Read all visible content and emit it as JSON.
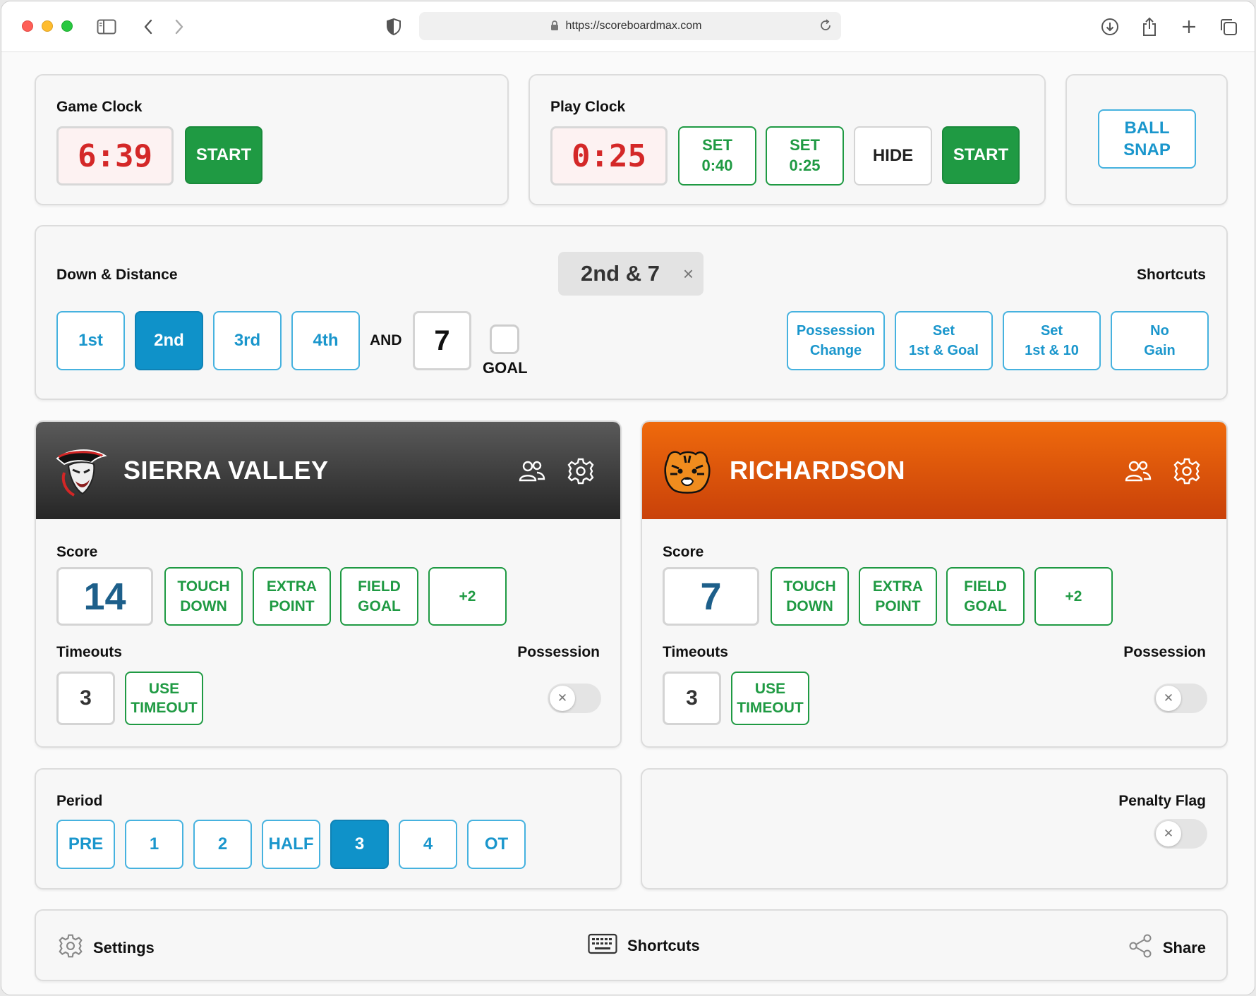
{
  "browser": {
    "url": "https://scoreboardmax.com",
    "icons": [
      "sidebar-icon",
      "back-icon",
      "forward-icon",
      "shield-icon",
      "lock-icon",
      "reload-icon",
      "download-icon",
      "share-icon",
      "new-tab-icon",
      "tabs-icon"
    ]
  },
  "game_clock": {
    "label": "Game Clock",
    "time": "6:39",
    "start_label": "START"
  },
  "play_clock": {
    "label": "Play Clock",
    "time": "0:25",
    "set_40_label": "SET\n0:40",
    "set_25_label": "SET\n0:25",
    "hide_label": "HIDE",
    "start_label": "START"
  },
  "ball_snap": {
    "label": "BALL\nSNAP"
  },
  "down_distance": {
    "label": "Down & Distance",
    "current": "2nd & 7",
    "clear_symbol": "×",
    "downs": [
      "1st",
      "2nd",
      "3rd",
      "4th"
    ],
    "selected_down": "2nd",
    "and_label": "AND",
    "distance": "7",
    "goal_label": "GOAL",
    "shortcuts_label": "Shortcuts",
    "shortcuts": [
      "Possession\nChange",
      "Set\n1st & Goal",
      "Set\n1st & 10",
      "No\nGain"
    ]
  },
  "teams": [
    {
      "name": "SIERRA VALLEY",
      "header_color": "#2f2f2f",
      "logo": "pirate-logo",
      "score_label": "Score",
      "score": "14",
      "score_buttons": [
        "TOUCH\nDOWN",
        "EXTRA\nPOINT",
        "FIELD\nGOAL",
        "+2"
      ],
      "timeouts_label": "Timeouts",
      "timeouts": "3",
      "use_timeout_label": "USE\nTIMEOUT",
      "possession_label": "Possession",
      "possession": false
    },
    {
      "name": "RICHARDSON",
      "header_color": "#e05a0b",
      "logo": "tiger-logo",
      "score_label": "Score",
      "score": "7",
      "score_buttons": [
        "TOUCH\nDOWN",
        "EXTRA\nPOINT",
        "FIELD\nGOAL",
        "+2"
      ],
      "timeouts_label": "Timeouts",
      "timeouts": "3",
      "use_timeout_label": "USE\nTIMEOUT",
      "possession_label": "Possession",
      "possession": false
    }
  ],
  "period": {
    "label": "Period",
    "options": [
      "PRE",
      "1",
      "2",
      "HALF",
      "3",
      "4",
      "OT"
    ],
    "selected": "3"
  },
  "penalty": {
    "label": "Penalty Flag",
    "on": false
  },
  "footer": {
    "settings_label": "Settings",
    "shortcuts_label": "Shortcuts",
    "share_label": "Share"
  },
  "colors": {
    "green": "#1f9a43",
    "blue": "#0f92c9",
    "clock_red": "#d42828",
    "orange": "#e05a0b"
  }
}
